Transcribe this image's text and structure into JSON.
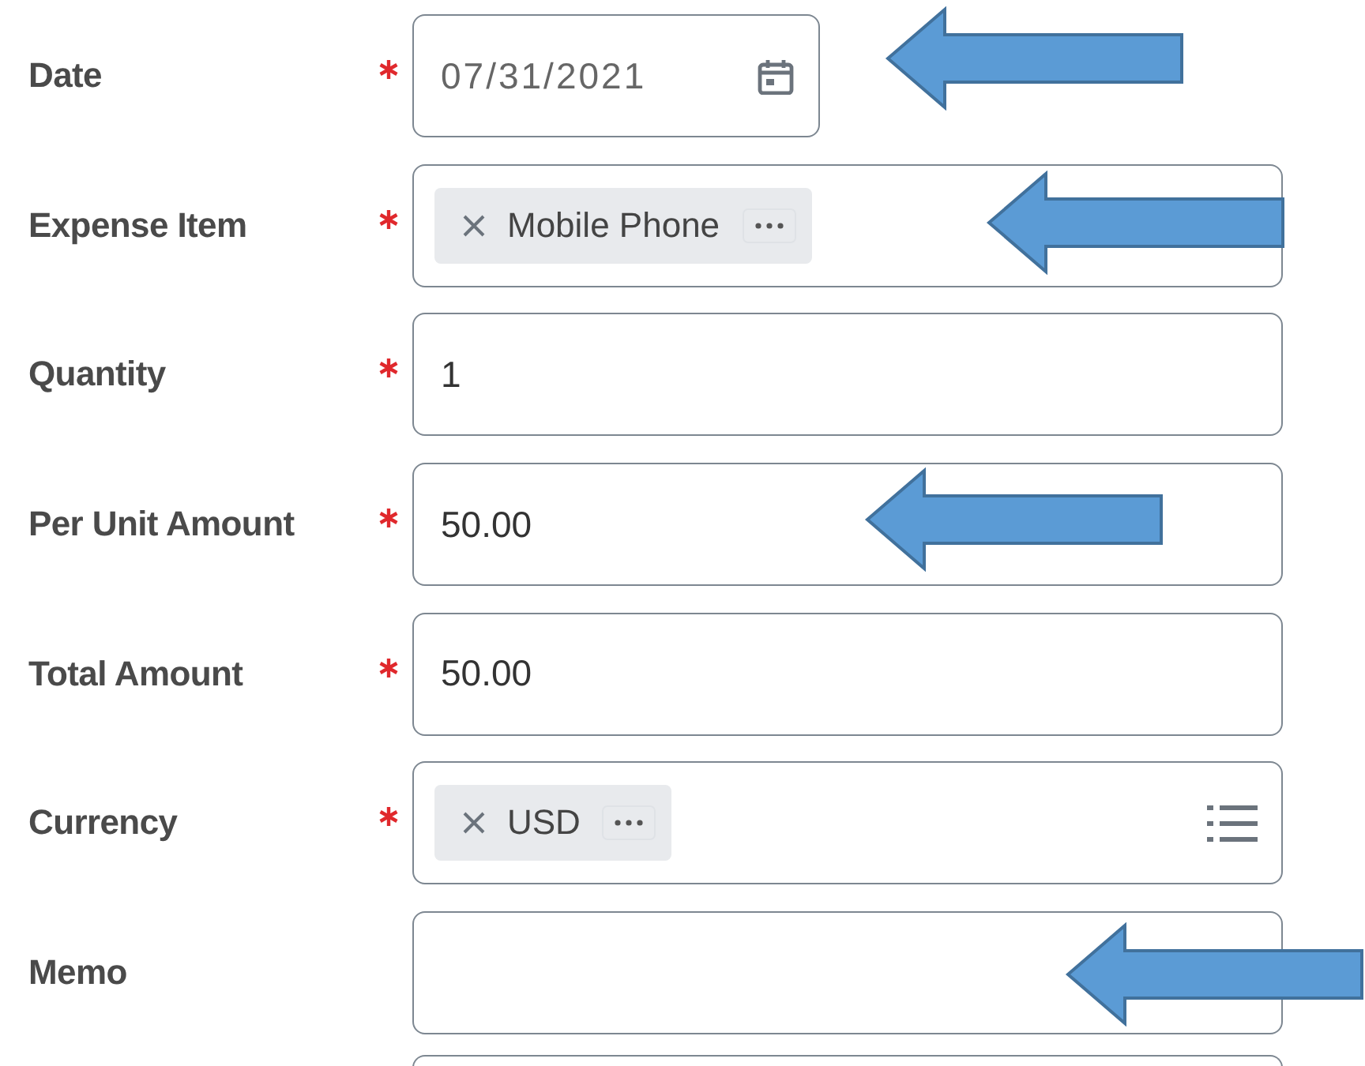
{
  "fields": [
    {
      "label": "Date",
      "required": true,
      "kind": "date",
      "value": "07/31/2021",
      "arrow": true
    },
    {
      "label": "Expense Item",
      "required": true,
      "kind": "chip",
      "chip": "Mobile Phone",
      "list_icon": false,
      "arrow": true
    },
    {
      "label": "Quantity",
      "required": true,
      "kind": "text",
      "value": "1",
      "arrow": false
    },
    {
      "label": "Per Unit Amount",
      "required": true,
      "kind": "text",
      "value": "50.00",
      "arrow": true
    },
    {
      "label": "Total Amount",
      "required": true,
      "kind": "text",
      "value": "50.00",
      "arrow": false
    },
    {
      "label": "Currency",
      "required": true,
      "kind": "chip",
      "chip": "USD",
      "list_icon": true,
      "arrow": false
    },
    {
      "label": "Memo",
      "required": false,
      "kind": "text",
      "arrow": true
    }
  ]
}
